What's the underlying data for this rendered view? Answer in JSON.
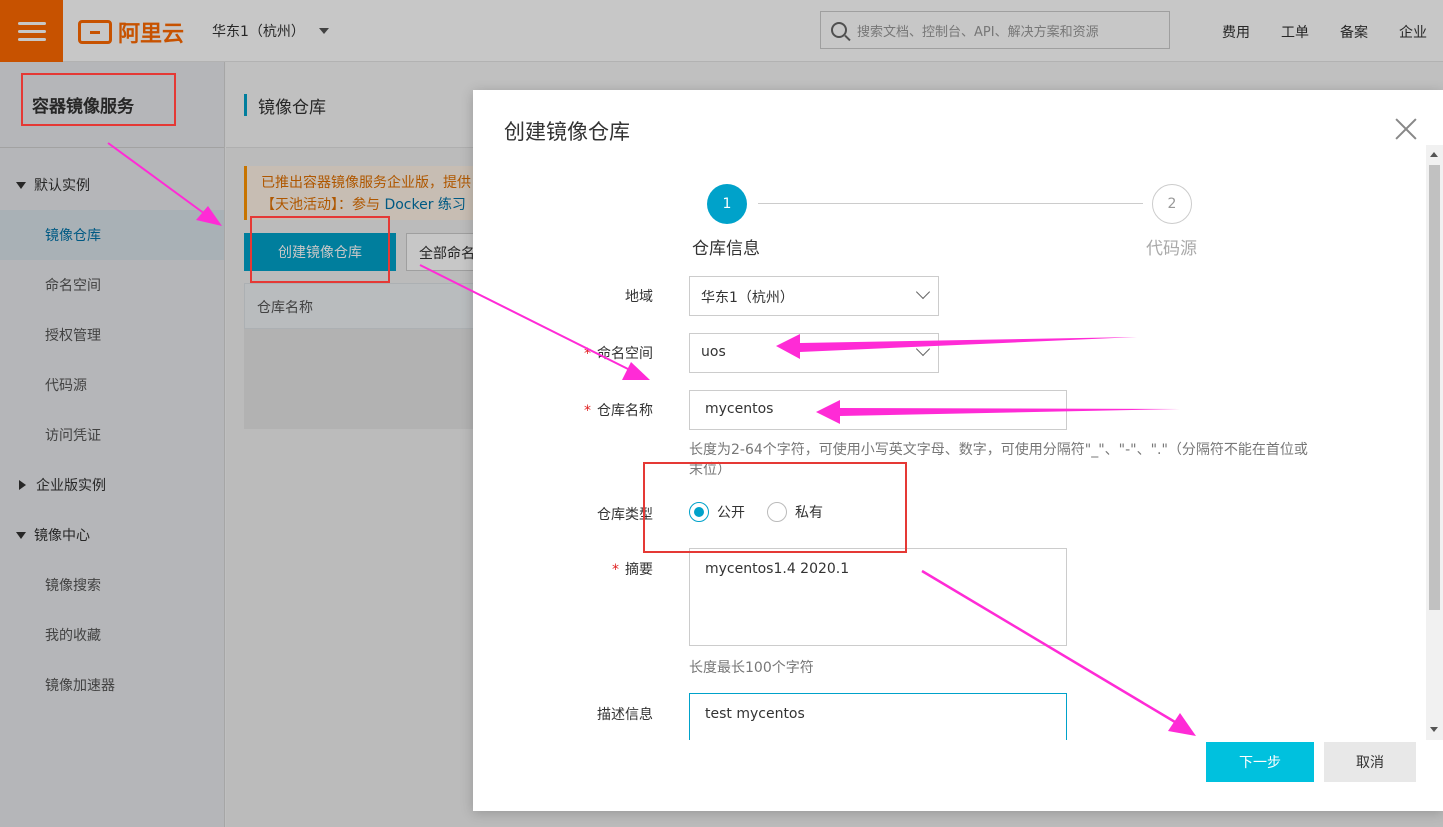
{
  "topbar": {
    "brand": "阿里云",
    "region": "华东1（杭州）",
    "search_placeholder": "搜索文档、控制台、API、解决方案和资源",
    "nav": [
      "费用",
      "工单",
      "备案",
      "企业"
    ]
  },
  "sidebar": {
    "title": "容器镜像服务",
    "groups": [
      {
        "label": "默认实例",
        "items": [
          "镜像仓库",
          "命名空间",
          "授权管理",
          "代码源",
          "访问凭证"
        ]
      },
      {
        "label": "企业版实例"
      },
      {
        "label": "镜像中心",
        "items": [
          "镜像搜索",
          "我的收藏",
          "镜像加速器"
        ]
      }
    ]
  },
  "main": {
    "title": "镜像仓库",
    "notice_line1": "已推出容器镜像服务企业版，提供",
    "notice_line2_prefix": "【天池活动】：参与 ",
    "notice_line2_link": "Docker 练习",
    "create_button": "创建镜像仓库",
    "namespace_filter": "全部命名",
    "table_header_name": "仓库名称"
  },
  "modal": {
    "title": "创建镜像仓库",
    "steps": [
      {
        "number": "1",
        "label": "仓库信息"
      },
      {
        "number": "2",
        "label": "代码源"
      }
    ],
    "fields": {
      "region_label": "地域",
      "region_value": "华东1（杭州）",
      "namespace_label": "命名空间",
      "namespace_value": "uos",
      "repo_name_label": "仓库名称",
      "repo_name_value": "mycentos",
      "repo_name_hint": "长度为2-64个字符，可使用小写英文字母、数字，可使用分隔符\"_\"、\"-\"、\".\"（分隔符不能在首位或末位）",
      "repo_type_label": "仓库类型",
      "repo_type_options": [
        "公开",
        "私有"
      ],
      "repo_type_selected": "公开",
      "summary_label": "摘要",
      "summary_value": "mycentos1.4 2020.1",
      "summary_hint": "长度最长100个字符",
      "description_label": "描述信息",
      "description_value": "test mycentos"
    },
    "required_mark": "*",
    "next_button": "下一步",
    "cancel_button": "取消"
  },
  "annotation_colors": {
    "arrow": "#ff2bd6",
    "box": "#e53935"
  }
}
